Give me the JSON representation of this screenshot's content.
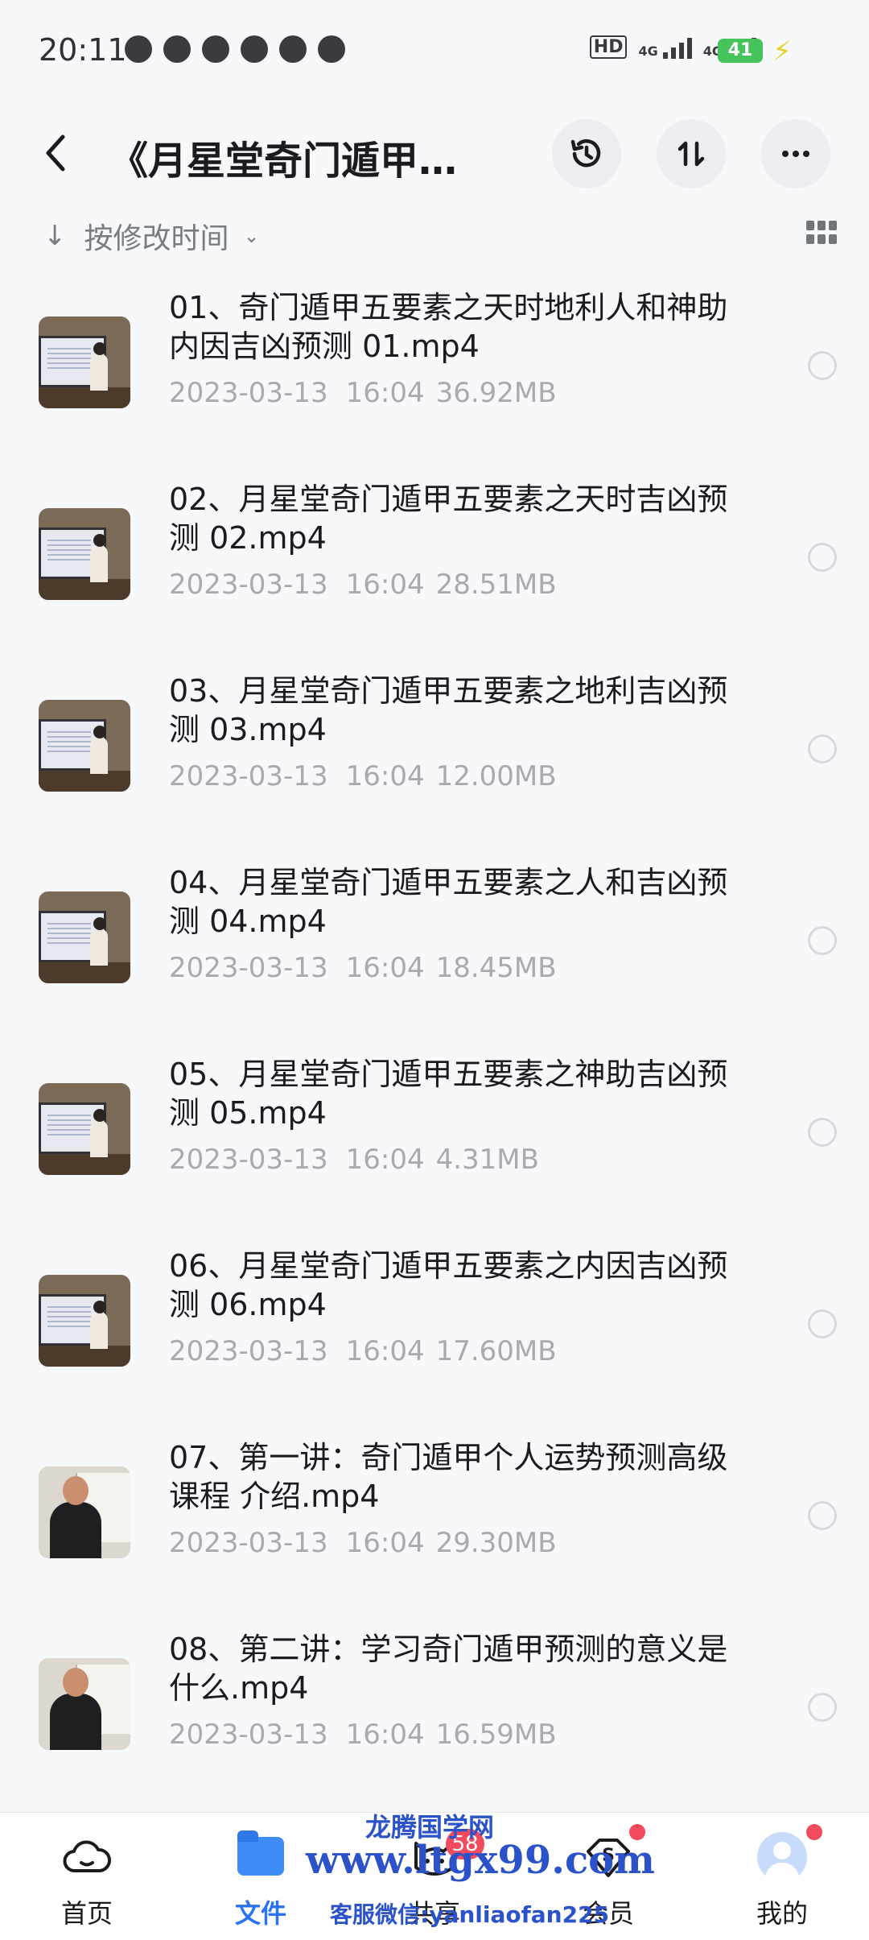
{
  "status_bar": {
    "time": "20:11",
    "hd_label": "HD",
    "network_1": "4G",
    "network_2": "4G",
    "battery": "41"
  },
  "header": {
    "title": "《月星堂奇门遁甲…",
    "history_icon": "history-clock-icon",
    "sort_icon": "sort-arrows-icon",
    "more_icon": "more-dots-icon"
  },
  "sort": {
    "label": "按修改时间"
  },
  "files": [
    {
      "name": "01、奇门遁甲五要素之天时地利人和神助内因吉凶预测 01.mp4",
      "date": "2023-03-13",
      "time": "16:04",
      "size": "36.92MB",
      "thumb": "classroom"
    },
    {
      "name": "02、月星堂奇门遁甲五要素之天时吉凶预测 02.mp4",
      "date": "2023-03-13",
      "time": "16:04",
      "size": "28.51MB",
      "thumb": "classroom"
    },
    {
      "name": "03、月星堂奇门遁甲五要素之地利吉凶预测 03.mp4",
      "date": "2023-03-13",
      "time": "16:04",
      "size": "12.00MB",
      "thumb": "classroom"
    },
    {
      "name": "04、月星堂奇门遁甲五要素之人和吉凶预测 04.mp4",
      "date": "2023-03-13",
      "time": "16:04",
      "size": "18.45MB",
      "thumb": "classroom"
    },
    {
      "name": "05、月星堂奇门遁甲五要素之神助吉凶预测 05.mp4",
      "date": "2023-03-13",
      "time": "16:04",
      "size": "4.31MB",
      "thumb": "classroom"
    },
    {
      "name": "06、月星堂奇门遁甲五要素之内因吉凶预测 06.mp4",
      "date": "2023-03-13",
      "time": "16:04",
      "size": "17.60MB",
      "thumb": "classroom"
    },
    {
      "name": "07、第一讲：奇门遁甲个人运势预测高级课程 介绍.mp4",
      "date": "2023-03-13",
      "time": "16:04",
      "size": "29.30MB",
      "thumb": "portrait"
    },
    {
      "name": "08、第二讲：学习奇门遁甲预测的意义是什么.mp4",
      "date": "2023-03-13",
      "time": "16:04",
      "size": "16.59MB",
      "thumb": "portrait"
    }
  ],
  "bottom_nav": {
    "home": "首页",
    "files": "文件",
    "share": "共享",
    "share_badge": "58",
    "vip": "会员",
    "me": "我的"
  },
  "watermark": {
    "line1": "龙腾国学网",
    "line2": "www.ltgx99.com",
    "line3": "客服微信:yanliaofan225"
  },
  "colors": {
    "accent": "#2b73f5",
    "badge_red": "#f24b5d",
    "meta_gray": "#a8aab0",
    "watermark_blue": "#2b52c9"
  }
}
